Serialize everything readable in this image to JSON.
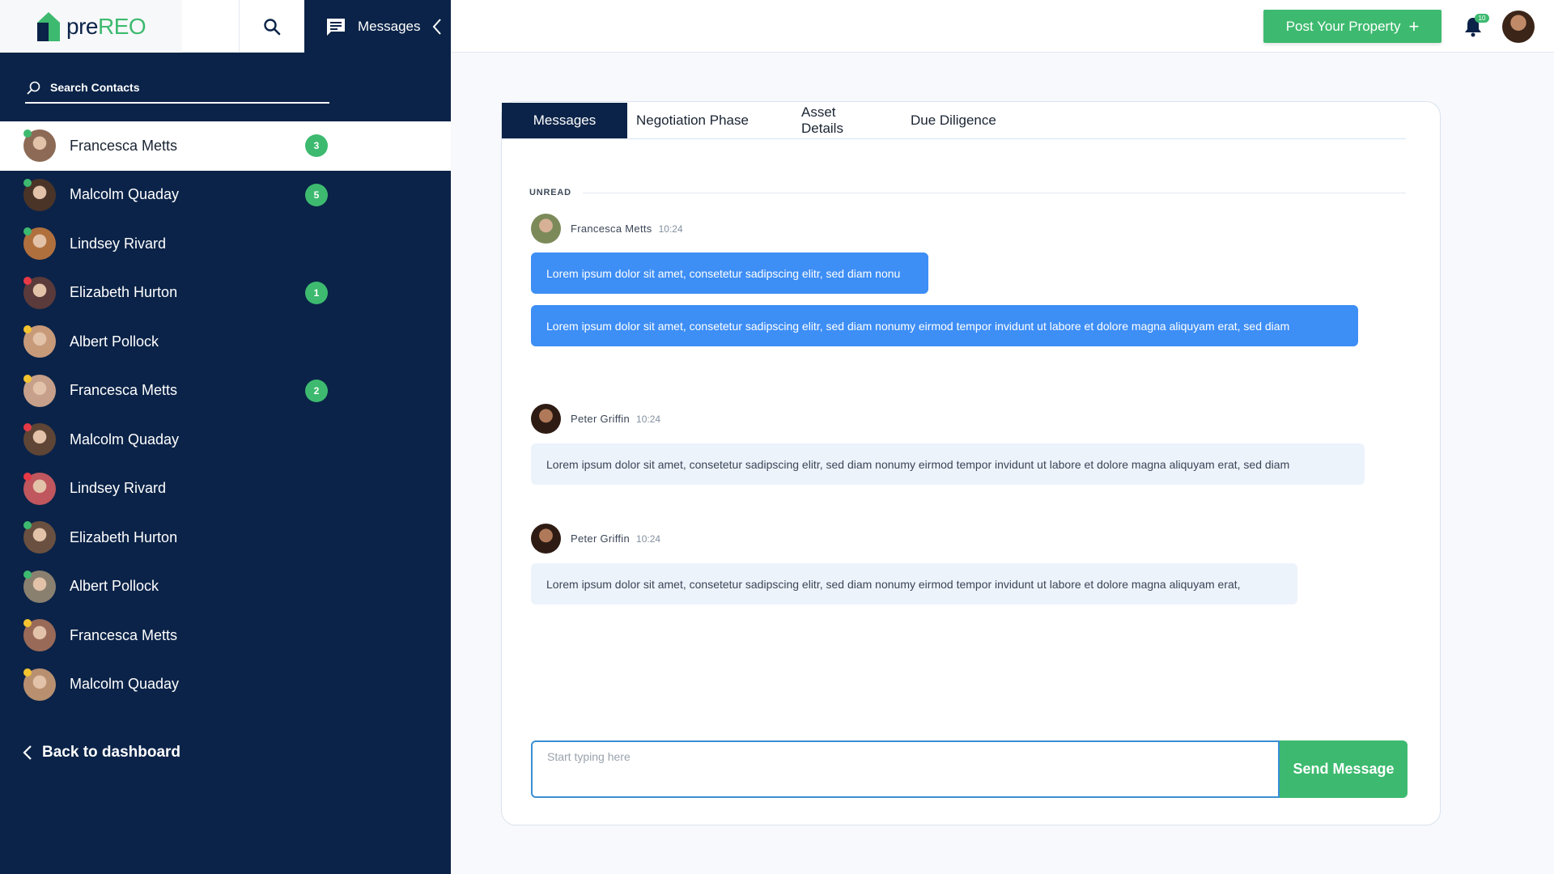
{
  "app": {
    "logo_pre": "pre",
    "logo_reo": "REO"
  },
  "header": {
    "messages_tab_label": "Messages",
    "post_button_label": "Post Your Property",
    "post_button_icon": "plus-icon",
    "notification_count": "10"
  },
  "sidebar": {
    "search_label": "Search Contacts",
    "contacts": [
      {
        "name": "Francesca Metts",
        "badge": "3",
        "status": "#3dba6f",
        "avatar": "#8c6a55",
        "active": true
      },
      {
        "name": "Malcolm Quaday",
        "badge": "5",
        "status": "#3dba6f",
        "avatar": "#4a3428"
      },
      {
        "name": "Lindsey Rivard",
        "badge": "",
        "status": "#3dba6f",
        "avatar": "#b0703e"
      },
      {
        "name": "Elizabeth Hurton",
        "badge": "1",
        "status": "#e63946",
        "avatar": "#5a3a3a"
      },
      {
        "name": "Albert Pollock",
        "badge": "",
        "status": "#f4c430",
        "avatar": "#c79a7a"
      },
      {
        "name": "Francesca Metts",
        "badge": "2",
        "status": "#f4c430",
        "avatar": "#c6a08a"
      },
      {
        "name": "Malcolm Quaday",
        "badge": "",
        "status": "#e63946",
        "avatar": "#5e4535"
      },
      {
        "name": "Lindsey Rivard",
        "badge": "",
        "status": "#e63946",
        "avatar": "#c0565e"
      },
      {
        "name": "Elizabeth Hurton",
        "badge": "",
        "status": "#3dba6f",
        "avatar": "#6a5040"
      },
      {
        "name": "Albert Pollock",
        "badge": "",
        "status": "#3dba6f",
        "avatar": "#8a8070"
      },
      {
        "name": "Francesca Metts",
        "badge": "",
        "status": "#f4c430",
        "avatar": "#9a6a58"
      },
      {
        "name": "Malcolm Quaday",
        "badge": "",
        "status": "#f4c430",
        "avatar": "#b89070"
      }
    ],
    "back_label": "Back to dashboard"
  },
  "tabs": [
    "Messages",
    "Negotiation Phase",
    "Asset Details",
    "Due Diligence"
  ],
  "chat": {
    "unread_label": "UNREAD",
    "groups": [
      {
        "sender": "Francesca Metts",
        "time": "10:24",
        "messages": [
          "Lorem ipsum dolor sit amet, consetetur sadipscing elitr, sed diam nonu",
          "Lorem ipsum dolor sit amet, consetetur sadipscing elitr, sed diam nonumy eirmod tempor invidunt ut labore et dolore magna aliquyam erat, sed diam"
        ]
      },
      {
        "sender": "Peter Griffin",
        "time": "10:24",
        "messages": [
          "Lorem ipsum dolor sit amet, consetetur sadipscing elitr, sed diam nonumy eirmod tempor invidunt ut labore et dolore magna aliquyam erat, sed diam"
        ]
      },
      {
        "sender": "Peter Griffin",
        "time": "10:24",
        "messages": [
          "Lorem ipsum dolor sit amet, consetetur sadipscing elitr, sed diam nonumy eirmod tempor invidunt ut labore et dolore magna aliquyam erat,"
        ]
      }
    ]
  },
  "composer": {
    "placeholder": "Start typing here",
    "value": "",
    "send_label": "Send Message"
  },
  "colors": {
    "navy": "#0b2348",
    "green": "#3dba6f",
    "blue_bubble": "#3d8ef5",
    "grey_bubble": "#edf3fb"
  }
}
